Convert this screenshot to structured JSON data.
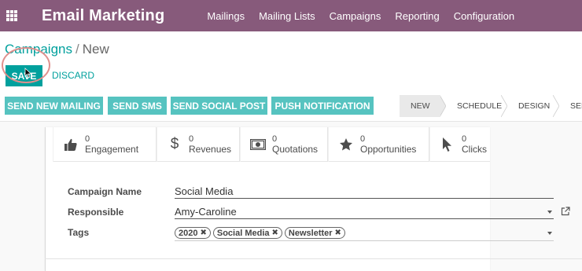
{
  "navbar": {
    "app_name": "Email Marketing",
    "menu": [
      "Mailings",
      "Mailing Lists",
      "Campaigns",
      "Reporting",
      "Configuration"
    ],
    "background": "#875a7b"
  },
  "breadcrumb": {
    "parent": "Campaigns",
    "separator": "/",
    "current": "New"
  },
  "buttons": {
    "save": "SAVE",
    "discard": "DISCARD"
  },
  "actions": [
    "SEND NEW MAILING",
    "SEND SMS",
    "SEND SOCIAL POST",
    "PUSH NOTIFICATION"
  ],
  "stages": [
    {
      "label": "NEW",
      "active": true
    },
    {
      "label": "SCHEDULE",
      "active": false
    },
    {
      "label": "DESIGN",
      "active": false
    },
    {
      "label": "SENT",
      "active": false
    }
  ],
  "smart_buttons": [
    {
      "value": "0",
      "label": "Engagement",
      "icon": "thumbs-up-icon"
    },
    {
      "value": "0",
      "label": "Revenues",
      "icon": "dollar-icon"
    },
    {
      "value": "0",
      "label": "Quotations",
      "icon": "money-bill-icon"
    },
    {
      "value": "0",
      "label": "Opportunities",
      "icon": "star-icon"
    },
    {
      "value": "0",
      "label": "Clicks",
      "icon": "cursor-icon"
    }
  ],
  "form": {
    "campaign_name": {
      "label": "Campaign Name",
      "value": "Social Media"
    },
    "responsible": {
      "label": "Responsible",
      "value": "Amy-Caroline"
    },
    "tags": {
      "label": "Tags",
      "values": [
        "2020",
        "Social Media",
        "Newsletter"
      ]
    }
  },
  "colors": {
    "accent": "#00a09d",
    "action_button": "#56c3c0"
  }
}
